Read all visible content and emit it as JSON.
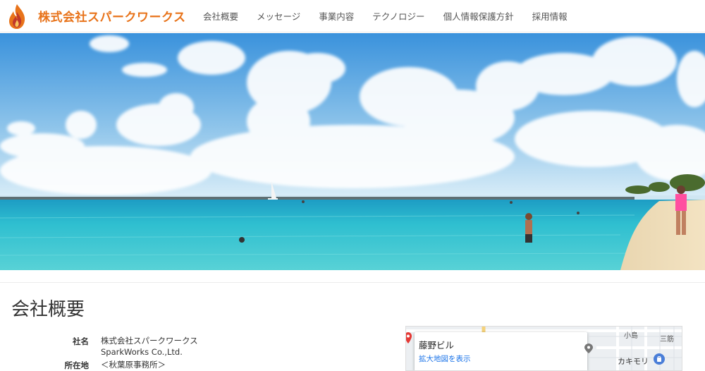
{
  "colors": {
    "brand": "#e8731a",
    "nav_text": "#555555",
    "sea": "#2bb7cf",
    "sky": "#3f9be0",
    "map_link": "#1a73e8"
  },
  "header": {
    "logo_icon": "flame-icon",
    "company_name": "株式会社スパークワークス",
    "nav": [
      {
        "label": "会社概要"
      },
      {
        "label": "メッセージ"
      },
      {
        "label": "事業内容"
      },
      {
        "label": "テクノロジー"
      },
      {
        "label": "個人情報保護方針"
      },
      {
        "label": "採用情報"
      }
    ]
  },
  "hero": {
    "image": "beach-sea-sky-photo"
  },
  "main": {
    "title": "会社概要",
    "info": {
      "name_label": "社名",
      "name_value": "株式会社スパークワークス",
      "name_value_en": "SparkWorks Co.,Ltd.",
      "address_label": "所在地",
      "address_value": "＜秋葉原事務所＞"
    }
  },
  "map": {
    "place_name": "藤野ビル",
    "enlarge_link": "拡大地図を表示",
    "labels": [
      "小島",
      "三筋",
      "カキモリ"
    ],
    "pin_icon": "map-pin-icon",
    "shop_icon": "shopping-bag-icon"
  }
}
